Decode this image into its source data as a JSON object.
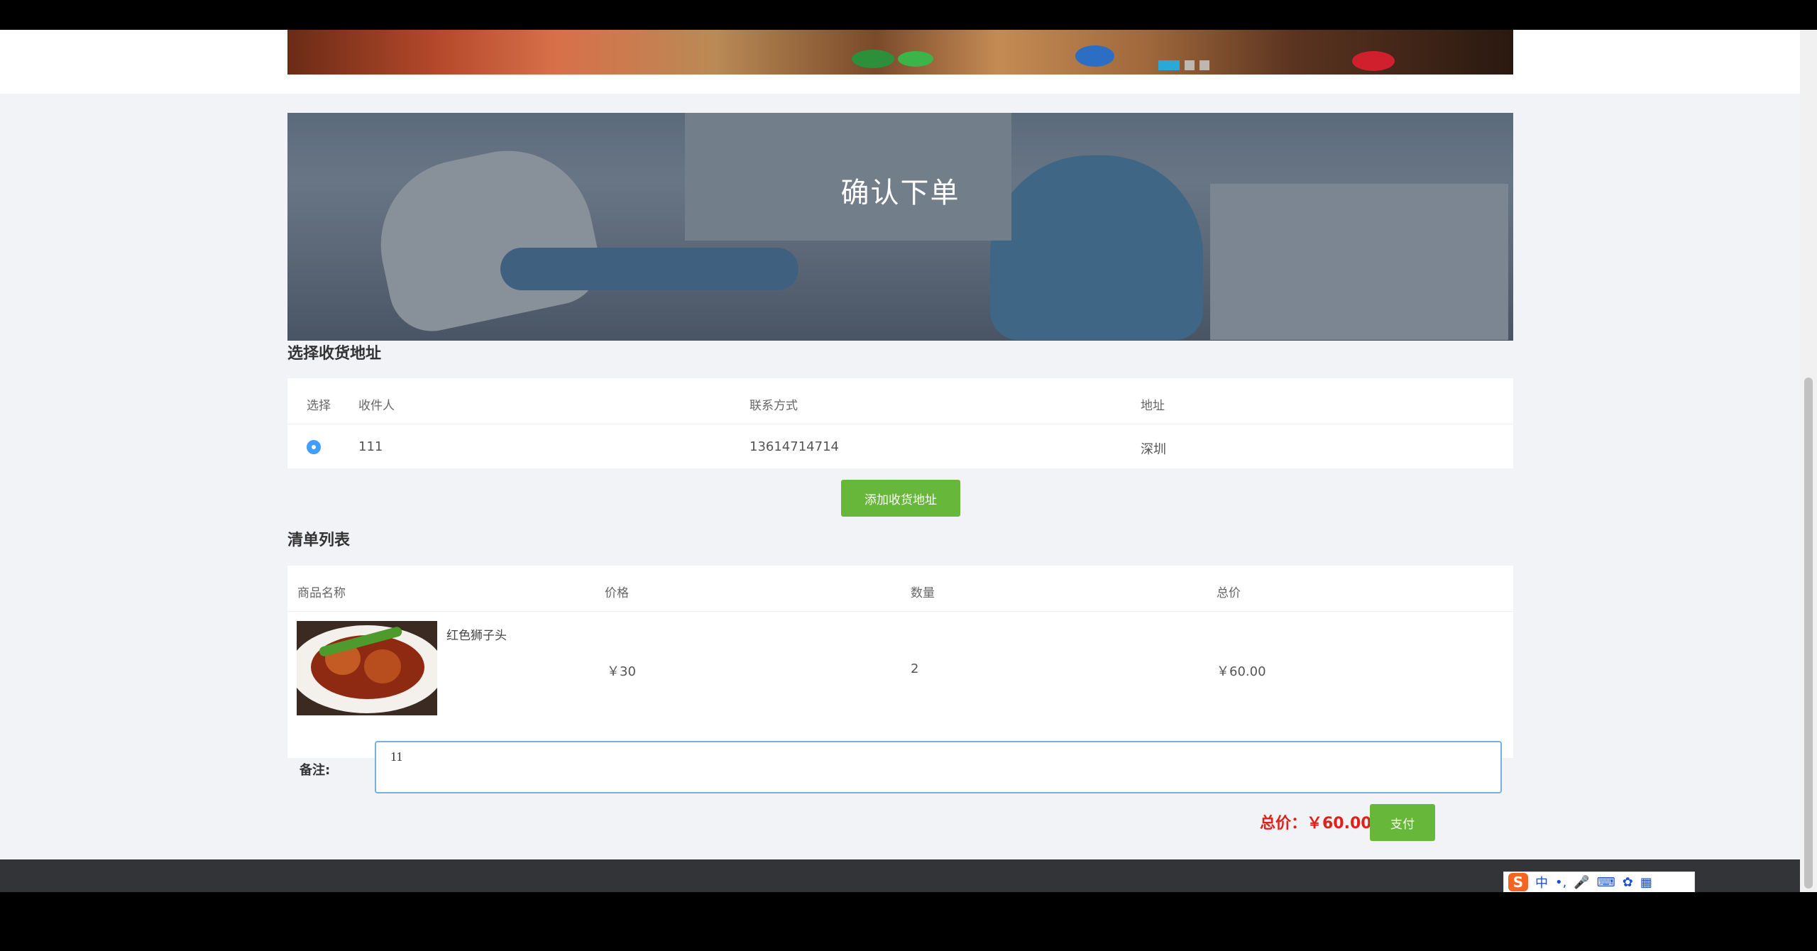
{
  "banner": {
    "title": "确认下单"
  },
  "address_section": {
    "title": "选择收货地址",
    "headers": {
      "select": "选择",
      "recipient": "收件人",
      "contact": "联系方式",
      "address": "地址"
    },
    "rows": [
      {
        "recipient": "111",
        "contact": "13614714714",
        "address": "深圳",
        "selected": true
      }
    ],
    "add_button": "添加收货地址"
  },
  "order_section": {
    "title": "清单列表",
    "headers": {
      "name": "商品名称",
      "price": "价格",
      "quantity": "数量",
      "total": "总价"
    },
    "items": [
      {
        "name": "红色狮子头",
        "price": "￥30",
        "quantity": "2",
        "total": "￥60.00"
      }
    ]
  },
  "remark": {
    "label": "备注:",
    "value": "11"
  },
  "checkout": {
    "total_label": "总价：￥60.00",
    "pay_button": "支付"
  },
  "ime": {
    "mode": "中",
    "punct": "•,",
    "logo": "S"
  },
  "colors": {
    "accent_green": "#67b83a",
    "price_red": "#e0201b",
    "radio_blue": "#409eff",
    "footer": "#323438"
  }
}
